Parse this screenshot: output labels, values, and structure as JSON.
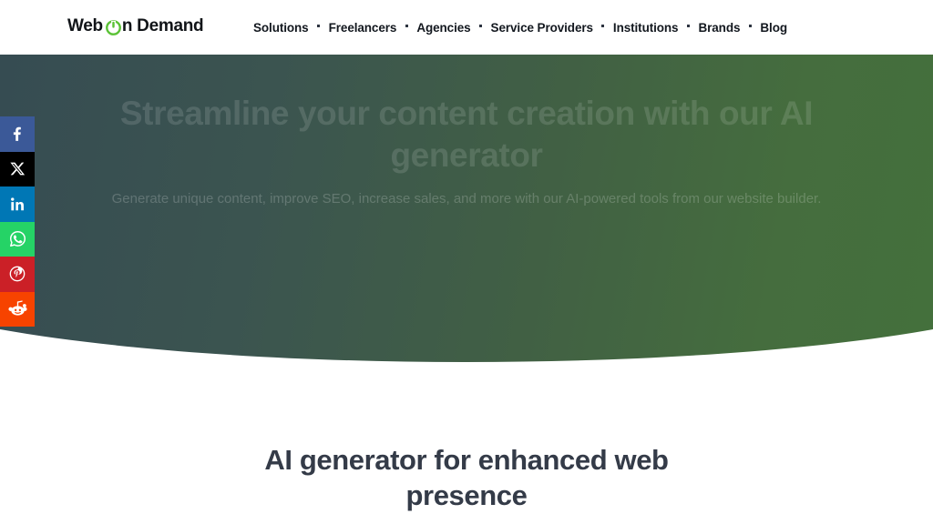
{
  "header": {
    "logo": {
      "text_before": "Web",
      "icon": "power-button-icon",
      "text_after": "n Demand",
      "full_text": "Web On Demand",
      "icon_color": "#5bc236"
    },
    "nav": [
      {
        "label": "Solutions",
        "has_separator": true
      },
      {
        "label": "Freelancers",
        "has_separator": true
      },
      {
        "label": "Agencies",
        "has_separator": true
      },
      {
        "label": "Service Providers",
        "has_separator": true
      },
      {
        "label": "Institutions",
        "has_separator": true
      },
      {
        "label": "Brands",
        "has_separator": true
      },
      {
        "label": "Blog",
        "has_separator": false
      }
    ]
  },
  "social_share": {
    "items": [
      {
        "name": "facebook",
        "label": "Share on Facebook",
        "color": "#3b5998",
        "glyph": "facebook-icon"
      },
      {
        "name": "x-twitter",
        "label": "Share on X",
        "color": "#000000",
        "glyph": "x-twitter-icon"
      },
      {
        "name": "linkedin",
        "label": "Share on LinkedIn",
        "color": "#0077b5",
        "glyph": "linkedin-icon"
      },
      {
        "name": "whatsapp",
        "label": "Share on WhatsApp",
        "color": "#25d366",
        "glyph": "whatsapp-icon"
      },
      {
        "name": "pinterest",
        "label": "Share on Pinterest",
        "color": "#cb2027",
        "glyph": "pinterest-icon"
      },
      {
        "name": "reddit",
        "label": "Share on Reddit",
        "color": "#f74300",
        "glyph": "reddit-icon"
      }
    ]
  },
  "hero": {
    "title": "Streamline your content creation with our AI generator",
    "subtitle": "Generate unique content, improve SEO, increase sales, and more with our AI-powered tools from our website builder.",
    "gradient_from": "#364c52",
    "gradient_to": "#44703c"
  },
  "section": {
    "title": "AI generator for enhanced web presence",
    "title_color": "#343b48"
  }
}
